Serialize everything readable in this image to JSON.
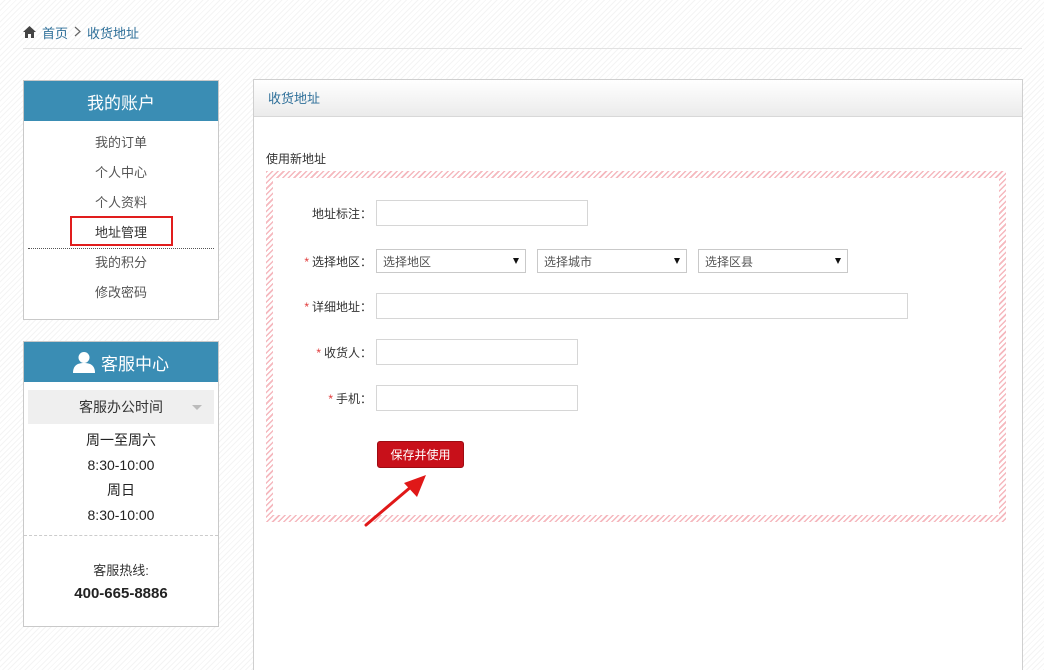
{
  "breadcrumb": {
    "home": "首页",
    "separator": ">",
    "current": "收货地址"
  },
  "sidebar": {
    "account": {
      "title": "我的账户",
      "items": [
        {
          "label": "我的订单"
        },
        {
          "label": "个人中心"
        },
        {
          "label": "个人资料"
        },
        {
          "label": "地址管理",
          "active": true
        },
        {
          "label": "我的积分"
        },
        {
          "label": "修改密码"
        }
      ]
    },
    "service": {
      "title": "客服中心",
      "office_hours_label": "客服办公时间",
      "hours": [
        "周一至周六",
        "8:30-10:00",
        "周日",
        "8:30-10:00"
      ],
      "hotline_label": "客服热线:",
      "hotline_number": "400-665-8886"
    }
  },
  "main": {
    "title": "收货地址",
    "new_address_label": "使用新地址",
    "form": {
      "tag_label": "地址标注：",
      "region_label": "选择地区：",
      "region_placeholder": "选择地区",
      "city_placeholder": "选择城市",
      "district_placeholder": "选择区县",
      "detail_label": "详细地址：",
      "receiver_label": "收货人：",
      "phone_label": "手机：",
      "required_mark": "*",
      "tag_value": "",
      "detail_value": "",
      "receiver_value": "",
      "phone_value": ""
    },
    "save_label": "保存并使用"
  },
  "colors": {
    "accent": "#3a8db4",
    "link": "#2e6f99",
    "primary_button": "#c8101a",
    "highlight_box": "#e11d1d",
    "hatch": "#f5b8be"
  },
  "icons": {
    "home": "home-icon",
    "chevron": "chevron-right-icon",
    "user": "user-icon",
    "caret": "caret-down-icon",
    "annotation": "annotation-arrow-icon"
  }
}
